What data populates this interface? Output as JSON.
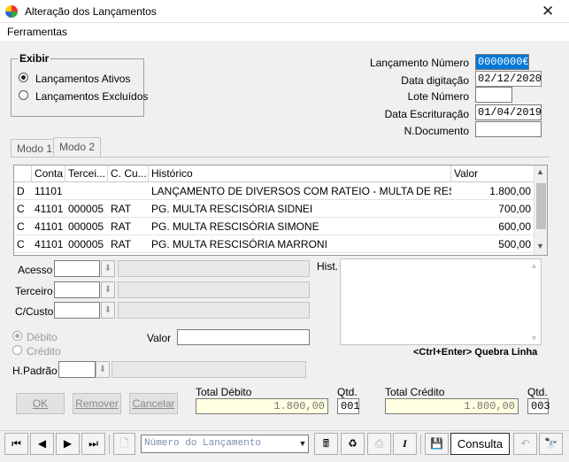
{
  "window": {
    "title": "Alteração dos Lançamentos",
    "close_glyph": "✕"
  },
  "menu": {
    "ferramentas": "Ferramentas"
  },
  "exibir": {
    "label": "Exibir",
    "options": [
      {
        "label": "Lançamentos Ativos",
        "checked": true
      },
      {
        "label": "Lançamentos Excluídos",
        "checked": false
      }
    ]
  },
  "header_fields": {
    "lancamento_numero": {
      "label": "Lançamento Número",
      "value": "0000000€"
    },
    "data_digitacao": {
      "label": "Data digitação",
      "value": "02/12/2020"
    },
    "lote_numero": {
      "label": "Lote Número",
      "value": ""
    },
    "data_escrituracao": {
      "label": "Data Escrituração",
      "value": "01/04/2019"
    },
    "n_documento": {
      "label": "N.Documento",
      "value": ""
    }
  },
  "tabs": [
    {
      "label": "Modo 1",
      "active": false
    },
    {
      "label": "Modo 2",
      "active": true
    }
  ],
  "grid": {
    "columns": [
      "",
      "Conta",
      "Tercei...",
      "C. Cu...",
      "Histórico",
      "Valor"
    ],
    "rows": [
      [
        "D",
        "11101",
        "",
        "",
        "LANÇAMENTO DE DIVERSOS COM RATEIO - MULTA DE RESCIS...",
        "1.800,00"
      ],
      [
        "C",
        "41101",
        "000005",
        "RAT",
        "PG. MULTA RESCISÓRIA SIDNEI",
        "700,00"
      ],
      [
        "C",
        "41101",
        "000005",
        "RAT",
        "PG. MULTA RESCISÓRIA SIMONE",
        "600,00"
      ],
      [
        "C",
        "41101",
        "000005",
        "RAT",
        "PG. MULTA RESCISÓRIA MARRONI",
        "500,00"
      ]
    ]
  },
  "detail": {
    "acesso_label": "Acesso",
    "terceiro_label": "Terceiro",
    "ccusto_label": "C/Custo",
    "debito_label": "Débito",
    "credito_label": "Crédito",
    "valor_label": "Valor",
    "hist_label": "Hist.",
    "hpadrao_label": "H.Padrão",
    "hint": "<Ctrl+Enter> Quebra Linha"
  },
  "buttons": {
    "ok": "OK",
    "remover": "Remover",
    "cancelar": "Cancelar"
  },
  "totals": {
    "total_debito_label": "Total Débito",
    "total_debito": "1.800,00",
    "qtd_label": "Qtd.",
    "qtd_debito": "001",
    "total_credito_label": "Total Crédito",
    "total_credito": "1.800,00",
    "qtd_credito": "003"
  },
  "toolbar": {
    "search_placeholder": "Número do Lançamento",
    "mode": "Consulta",
    "italic_glyph": "I"
  }
}
